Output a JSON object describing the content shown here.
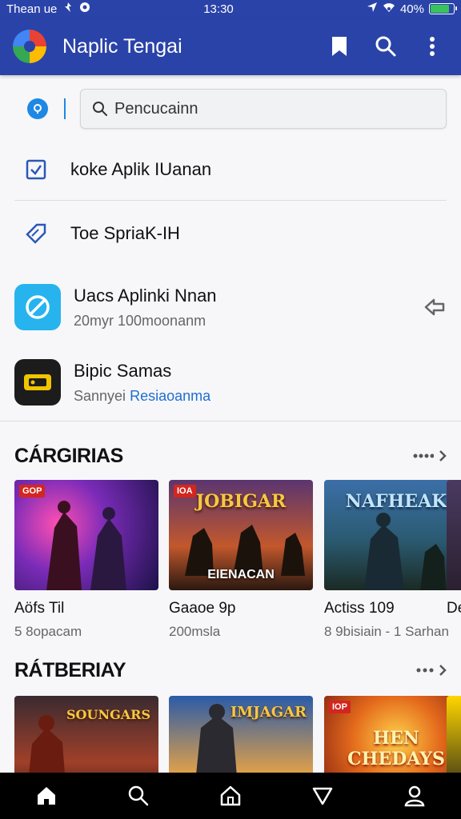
{
  "status": {
    "carrier": "Thean ue",
    "time": "13:30",
    "battery_percent": "40%",
    "battery_level": 0.9,
    "battery_color": "#37c45a"
  },
  "appbar": {
    "title": "Naplic Tengai",
    "bg_color": "#2a43a8",
    "actions": [
      "bookmark-icon",
      "search-icon",
      "more-vert-icon"
    ]
  },
  "search": {
    "placeholder": "Pencucainn"
  },
  "menu": [
    {
      "label": "koke Aplik IUanan",
      "icon": "checkbox-icon"
    },
    {
      "label": "Toe SpriaK-IH",
      "icon": "tag-icon"
    }
  ],
  "apps": [
    {
      "title": "Uacs Aplinki Nnan",
      "subtitle": "20myr 100moonanm",
      "icon": "link-app-icon",
      "icon_color": "#27b3ee"
    },
    {
      "title": "Bipic Samas",
      "subtitle_prefix": "Sannyei",
      "subtitle_link": "Resiaoanma",
      "icon": "games-app-icon",
      "icon_color": "#1c1c1c"
    }
  ],
  "section1": {
    "title": "CÁRGIRIAS",
    "cards": [
      {
        "title": "Aöfs Til",
        "subtitle": "5 8opacam",
        "tag": "GOP",
        "overlay": ""
      },
      {
        "title": "Gaaoe 9p",
        "subtitle": "200msla",
        "tag": "IOA",
        "overlay": "EIENACAN",
        "topword": "JOBIGAR"
      },
      {
        "title": "Actiss 109",
        "subtitle": "8 9bisiain - 1 Sarhan",
        "tag": "",
        "overlay": "",
        "topword": "NAFHEAK"
      },
      {
        "title": "De",
        "subtitle": "",
        "tag": "",
        "overlay": ""
      }
    ]
  },
  "section2": {
    "title": "RÁTBERIAY",
    "cards": [
      {
        "title": "",
        "subtitle": "",
        "tag": "",
        "topword": "SOUNGARS"
      },
      {
        "title": "",
        "subtitle": "",
        "tag": "",
        "topword": "IMJAGAR"
      },
      {
        "title": "",
        "subtitle": "",
        "tag": "IOP",
        "topword": "HEN CHEDAYS"
      }
    ]
  },
  "bottom_nav": [
    "home-icon",
    "search-icon",
    "house-icon",
    "filter-icon",
    "profile-icon"
  ]
}
